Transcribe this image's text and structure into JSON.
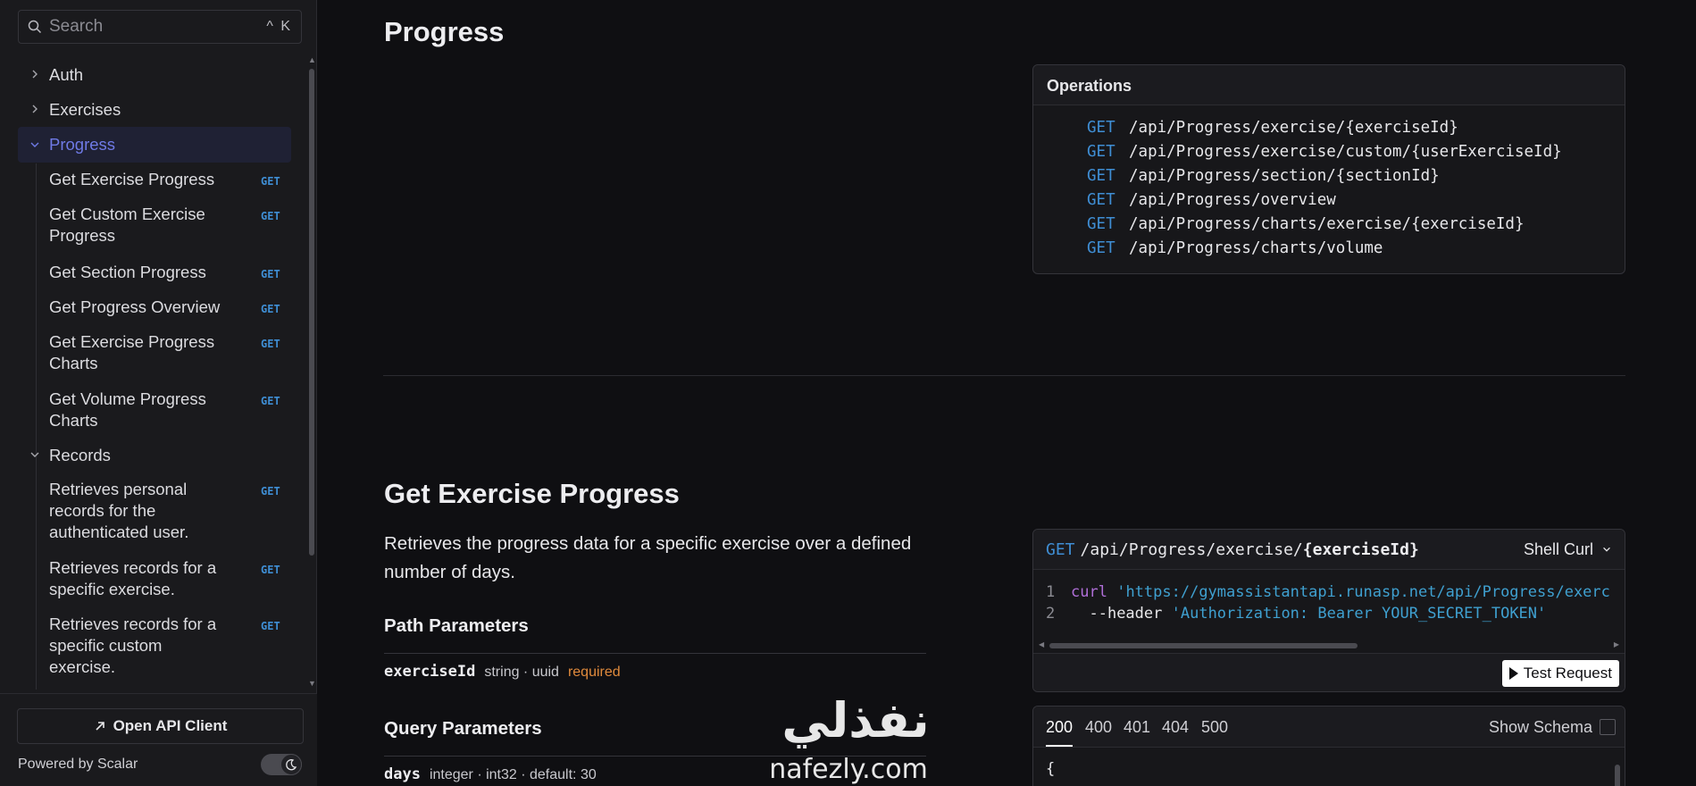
{
  "search": {
    "placeholder": "Search",
    "shortcut": "^ K"
  },
  "sidebar": {
    "groups": [
      {
        "label": "Auth"
      },
      {
        "label": "Exercises"
      },
      {
        "label": "Progress"
      },
      {
        "label": "Records"
      }
    ],
    "progress_items": [
      {
        "label_1": "Get Exercise Progress",
        "label_2": "",
        "method": "GET"
      },
      {
        "label_1": "Get Custom Exercise",
        "label_2": "Progress",
        "method": "GET"
      },
      {
        "label_1": "Get Section Progress",
        "label_2": "",
        "method": "GET"
      },
      {
        "label_1": "Get Progress Overview",
        "label_2": "",
        "method": "GET"
      },
      {
        "label_1": "Get Exercise Progress",
        "label_2": "Charts",
        "method": "GET"
      },
      {
        "label_1": "Get Volume Progress",
        "label_2": "Charts",
        "method": "GET"
      }
    ],
    "records_items": [
      {
        "label_1": "Retrieves personal",
        "label_2": "records for the",
        "label_3": "authenticated user.",
        "method": "GET"
      },
      {
        "label_1": "Retrieves records for a",
        "label_2": "specific exercise.",
        "method": "GET"
      },
      {
        "label_1": "Retrieves records for a",
        "label_2": "specific custom",
        "label_3": "exercise.",
        "method": "GET"
      }
    ],
    "open_client": "Open API Client",
    "powered_by": "Powered by Scalar"
  },
  "main": {
    "section_title": "Progress",
    "operations": {
      "title": "Operations",
      "items": [
        {
          "method": "GET",
          "path": "/api/Progress/exercise/{exerciseId}"
        },
        {
          "method": "GET",
          "path": "/api/Progress/exercise/custom/{userExerciseId}"
        },
        {
          "method": "GET",
          "path": "/api/Progress/section/{sectionId}"
        },
        {
          "method": "GET",
          "path": "/api/Progress/overview"
        },
        {
          "method": "GET",
          "path": "/api/Progress/charts/exercise/{exerciseId}"
        },
        {
          "method": "GET",
          "path": "/api/Progress/charts/volume"
        }
      ]
    },
    "endpoint": {
      "title": "Get Exercise Progress",
      "description": "Retrieves the progress data for a specific exercise over a defined number of days.",
      "path_params_title": "Path Parameters",
      "path_param": {
        "name": "exerciseId",
        "type": "string · uuid",
        "required": "required"
      },
      "query_params_title": "Query Parameters",
      "query_param": {
        "name": "days",
        "type": "integer · int32 · default: 30"
      }
    },
    "request": {
      "method": "GET",
      "path_prefix": "/api/Progress/exercise/",
      "path_param": "{exerciseId}",
      "language": "Shell Curl",
      "line1_no": "1",
      "line1_cmd": "curl",
      "line1_url": "'https://gymassistantapi.runasp.net/api/Progress/exerc",
      "line2_no": "2",
      "line2_flag": "--header",
      "line2_val": "'Authorization: Bearer YOUR_SECRET_TOKEN'",
      "test_button": "Test Request"
    },
    "response": {
      "tabs": [
        "200",
        "400",
        "401",
        "404",
        "500"
      ],
      "show_schema": "Show Schema",
      "body_start": "{"
    }
  },
  "watermark": {
    "arabic": "نفذلي",
    "latin": "nafezly.com"
  },
  "colors": {
    "accent": "#6f7ae6",
    "get_method": "#3f8ed4",
    "required": "#e08a3c",
    "background": "#0f0f12",
    "sidebar": "#1a1a1d"
  }
}
